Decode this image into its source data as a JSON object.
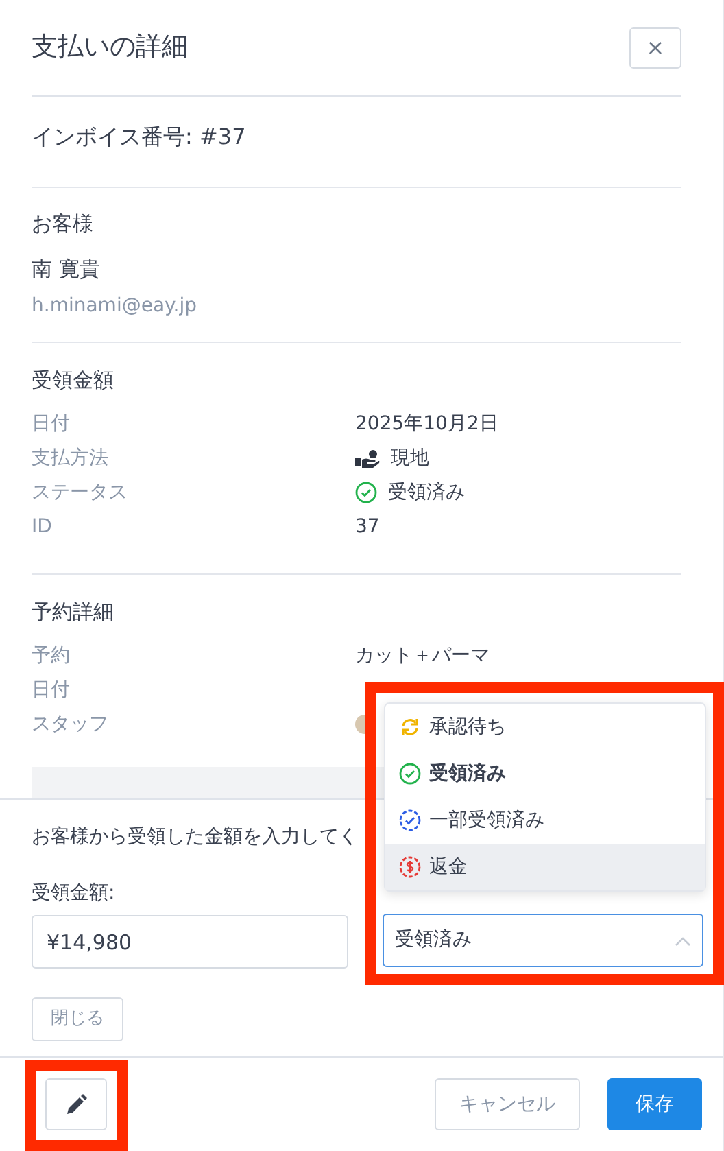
{
  "title": "支払いの詳細",
  "close_label": "×",
  "invoice": "インボイス番号: #37",
  "customer": {
    "heading": "お客様",
    "name": "南 寛貴",
    "email": "h.minami@eay.jp"
  },
  "payment": {
    "heading": "受領金額",
    "rows": [
      {
        "label": "日付",
        "value": "2025年10月2日"
      },
      {
        "label": "支払方法",
        "value": "現地",
        "kind": "cash"
      },
      {
        "label": "ステータス",
        "value": "受領済み",
        "kind": "received"
      },
      {
        "label": "ID",
        "value": "37"
      }
    ]
  },
  "booking": {
    "heading": "予約詳細",
    "rows": [
      {
        "label": "予約",
        "value": "カット＋パーマ"
      },
      {
        "label": "日付"
      },
      {
        "label": "スタッフ",
        "avatar": true
      }
    ]
  },
  "form": {
    "instruction": "お客様から受領した金額を入力してく",
    "amount_label": "受領金額:",
    "amount_value": "¥14,980",
    "status": {
      "value": "受領済み",
      "expanded": true,
      "highlighted": true,
      "options": [
        {
          "label": "承認待ち",
          "kind": "pending",
          "selected": false,
          "hovered": false
        },
        {
          "label": "受領済み",
          "kind": "received",
          "selected": true,
          "hovered": false
        },
        {
          "label": "一部受領済み",
          "kind": "partial",
          "selected": false,
          "hovered": false
        },
        {
          "label": "返金",
          "kind": "refund",
          "selected": false,
          "hovered": true
        }
      ]
    },
    "close_button": "閉じる"
  },
  "footer": {
    "edit_highlighted": true,
    "cancel": "キャンセル",
    "save": "保存"
  }
}
